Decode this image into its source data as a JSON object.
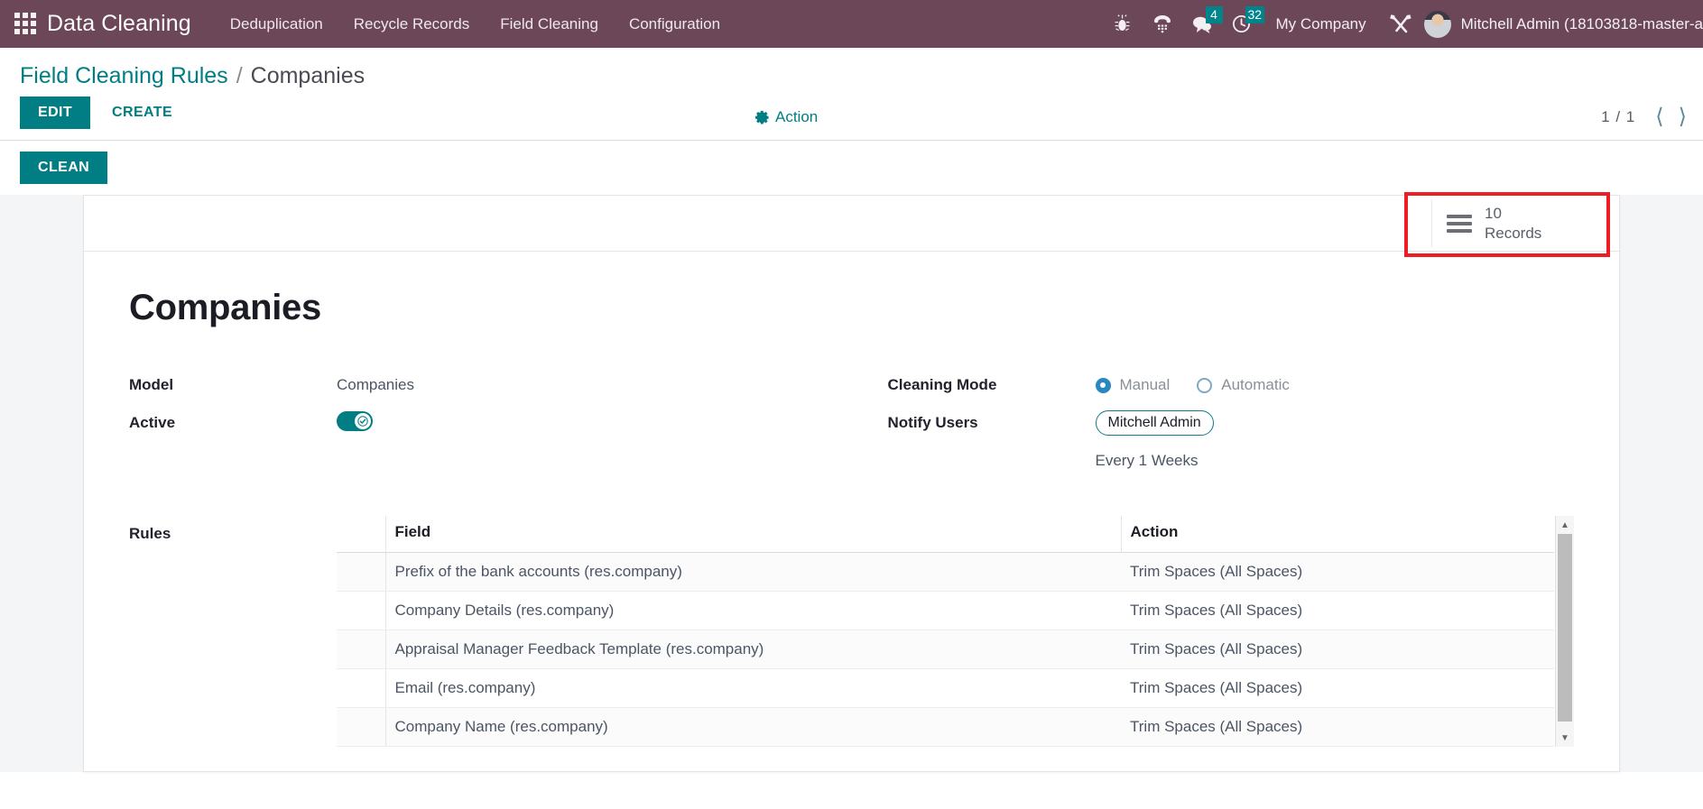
{
  "navbar": {
    "apps_icon": "apps-grid-icon",
    "brand": "Data Cleaning",
    "menu": [
      {
        "label": "Deduplication"
      },
      {
        "label": "Recycle Records"
      },
      {
        "label": "Field Cleaning"
      },
      {
        "label": "Configuration"
      }
    ],
    "icons": [
      {
        "name": "bug-icon",
        "badge": null
      },
      {
        "name": "voip-phone-icon",
        "badge": null
      },
      {
        "name": "messages-icon",
        "badge": "4"
      },
      {
        "name": "activities-clock-icon",
        "badge": "32"
      }
    ],
    "company": "My Company",
    "settings_icon": "tools-wrench-screwdriver-icon",
    "user": "Mitchell Admin (18103818-master-a",
    "accent": "#6b4758",
    "badge_color": "#00848c"
  },
  "control_panel": {
    "breadcrumb": {
      "parent": "Field Cleaning Rules",
      "separator": "/",
      "current": "Companies"
    },
    "edit_label": "EDIT",
    "create_label": "CREATE",
    "action_label": "Action",
    "clean_label": "CLEAN",
    "pager": {
      "counter": "1 / 1",
      "prev_icon": "chevron-left-icon",
      "next_icon": "chevron-right-icon"
    },
    "primary_color": "#017e84"
  },
  "sheet": {
    "smart_button": {
      "icon": "list-bars-icon",
      "value": "10",
      "label": "Records",
      "highlight_color": "#ee1c25"
    },
    "title": "Companies",
    "fields": {
      "model_label": "Model",
      "model_value": "Companies",
      "active_label": "Active",
      "active_value": true,
      "cleaning_mode_label": "Cleaning Mode",
      "cleaning_mode_options": [
        {
          "label": "Manual",
          "selected": true
        },
        {
          "label": "Automatic",
          "selected": false
        }
      ],
      "notify_users_label": "Notify Users",
      "notify_users_tags": [
        "Mitchell Admin"
      ],
      "interval_text": "Every  1  Weeks"
    },
    "rules": {
      "label": "Rules",
      "columns": [
        "",
        "Field",
        "Action"
      ],
      "rows": [
        {
          "field": "Prefix of the bank accounts (res.company)",
          "action": "Trim Spaces (All Spaces)"
        },
        {
          "field": "Company Details (res.company)",
          "action": "Trim Spaces (All Spaces)"
        },
        {
          "field": "Appraisal Manager Feedback Template (res.company)",
          "action": "Trim Spaces (All Spaces)"
        },
        {
          "field": "Email (res.company)",
          "action": "Trim Spaces (All Spaces)"
        },
        {
          "field": "Company Name (res.company)",
          "action": "Trim Spaces (All Spaces)"
        }
      ],
      "scroll_up_icon": "triangle-up-icon",
      "scroll_down_icon": "triangle-down-icon"
    }
  }
}
